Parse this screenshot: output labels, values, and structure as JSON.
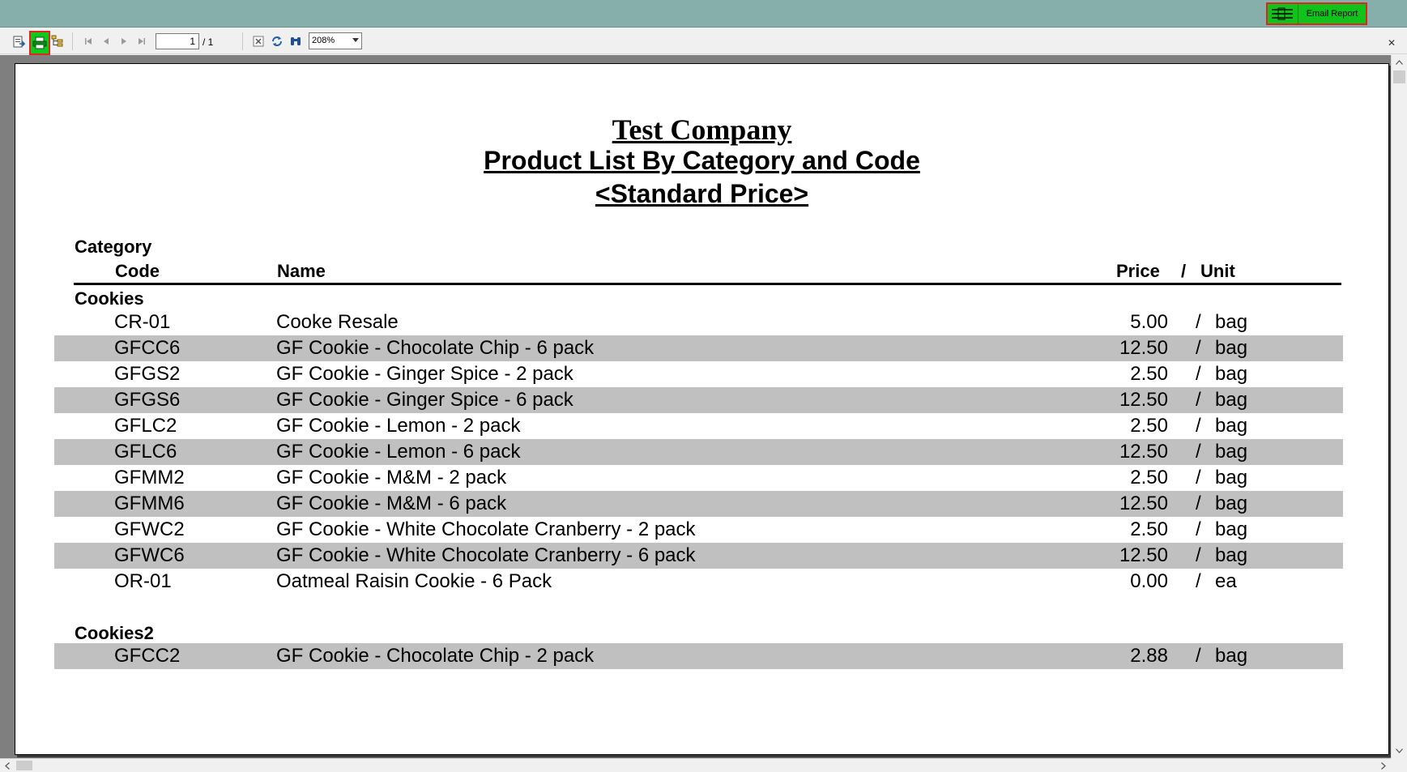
{
  "toolbar": {
    "page_current": "1",
    "page_total": "/ 1",
    "zoom": "208%",
    "email_report_label": "Email Report"
  },
  "report": {
    "company": "Test Company",
    "title": "Product List By Category and Code",
    "subtitle": "<Standard Price>",
    "headers": {
      "category": "Category",
      "code": "Code",
      "name": "Name",
      "price": "Price",
      "slash": "/",
      "unit": "Unit"
    },
    "groups": [
      {
        "name": "Cookies",
        "rows": [
          {
            "code": "CR-01",
            "name": "Cooke Resale",
            "price": "5.00",
            "slash": "/",
            "unit": "bag"
          },
          {
            "code": "GFCC6",
            "name": "GF Cookie - Chocolate Chip - 6 pack",
            "price": "12.50",
            "slash": "/",
            "unit": "bag"
          },
          {
            "code": "GFGS2",
            "name": "GF Cookie - Ginger Spice - 2 pack",
            "price": "2.50",
            "slash": "/",
            "unit": "bag"
          },
          {
            "code": "GFGS6",
            "name": "GF Cookie - Ginger Spice - 6 pack",
            "price": "12.50",
            "slash": "/",
            "unit": "bag"
          },
          {
            "code": "GFLC2",
            "name": "GF Cookie - Lemon - 2 pack",
            "price": "2.50",
            "slash": "/",
            "unit": "bag"
          },
          {
            "code": "GFLC6",
            "name": "GF Cookie - Lemon - 6 pack",
            "price": "12.50",
            "slash": "/",
            "unit": "bag"
          },
          {
            "code": "GFMM2",
            "name": "GF Cookie - M&M - 2 pack",
            "price": "2.50",
            "slash": "/",
            "unit": "bag"
          },
          {
            "code": "GFMM6",
            "name": "GF Cookie - M&M - 6 pack",
            "price": "12.50",
            "slash": "/",
            "unit": "bag"
          },
          {
            "code": "GFWC2",
            "name": "GF Cookie - White Chocolate Cranberry - 2 pack",
            "price": "2.50",
            "slash": "/",
            "unit": "bag"
          },
          {
            "code": "GFWC6",
            "name": "GF Cookie - White Chocolate Cranberry - 6 pack",
            "price": "12.50",
            "slash": "/",
            "unit": "bag"
          },
          {
            "code": "OR-01",
            "name": "Oatmeal Raisin Cookie - 6 Pack",
            "price": "0.00",
            "slash": "/",
            "unit": "ea"
          }
        ]
      },
      {
        "name": "Cookies2",
        "rows": [
          {
            "code": "GFCC2",
            "name": "GF Cookie - Chocolate Chip - 2 pack",
            "price": "2.88",
            "slash": "/",
            "unit": "bag"
          }
        ]
      }
    ]
  },
  "icons": {
    "export": "export-icon",
    "print": "print-icon",
    "group_tree": "group-tree-icon",
    "first_page": "first-page-icon",
    "prev_page": "prev-page-icon",
    "next_page": "next-page-icon",
    "last_page": "last-page-icon",
    "stop": "stop-icon",
    "refresh": "refresh-icon",
    "search": "binoculars-icon",
    "email": "email-list-icon",
    "close": "close-icon"
  },
  "colors": {
    "banner": "#86aeab",
    "highlight_green": "#12c81e",
    "highlight_border": "#e0251f",
    "row_shade": "#c0c0c0",
    "viewer_bg": "#7f7f7f"
  }
}
